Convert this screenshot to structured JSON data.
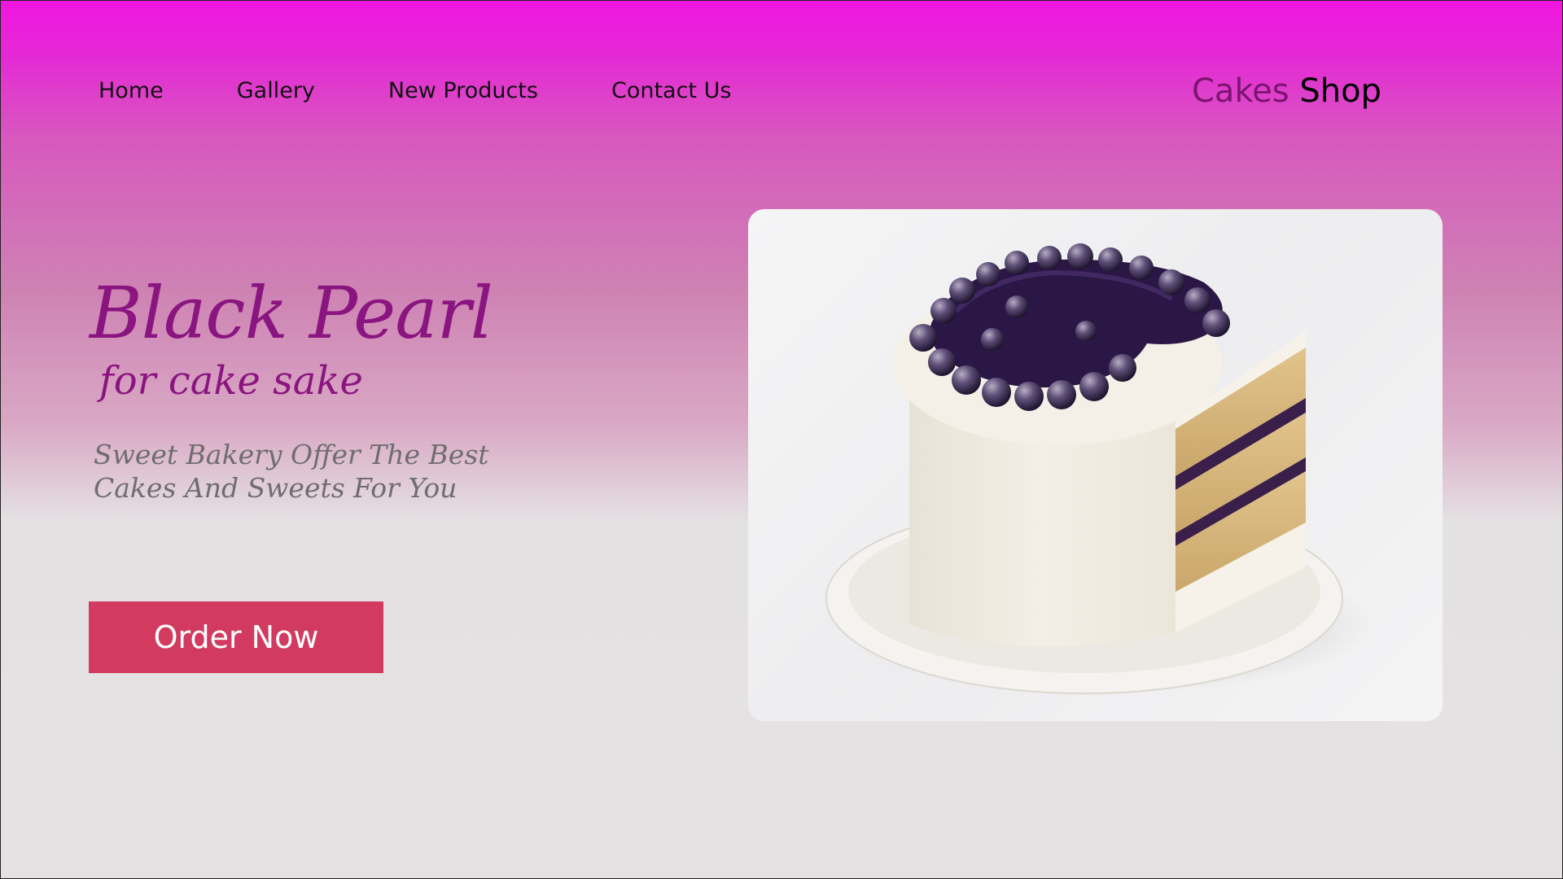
{
  "nav": {
    "items": [
      {
        "label": "Home"
      },
      {
        "label": "Gallery"
      },
      {
        "label": "New Products"
      },
      {
        "label": "Contact Us"
      }
    ]
  },
  "brand": {
    "part1": "Cakes",
    "part2": "Shop"
  },
  "hero": {
    "title": "Black Pearl",
    "subtitle": "for cake sake",
    "description": "Sweet  Bakery Offer The Best   Cakes And Sweets For You",
    "cta_label": "Order Now"
  },
  "colors": {
    "header_top": "#f015e0",
    "title_purple": "#8a1580",
    "brand_purple": "#7c1470",
    "button_bg": "#d23a5f",
    "page_bg": "#e6e2e4"
  }
}
